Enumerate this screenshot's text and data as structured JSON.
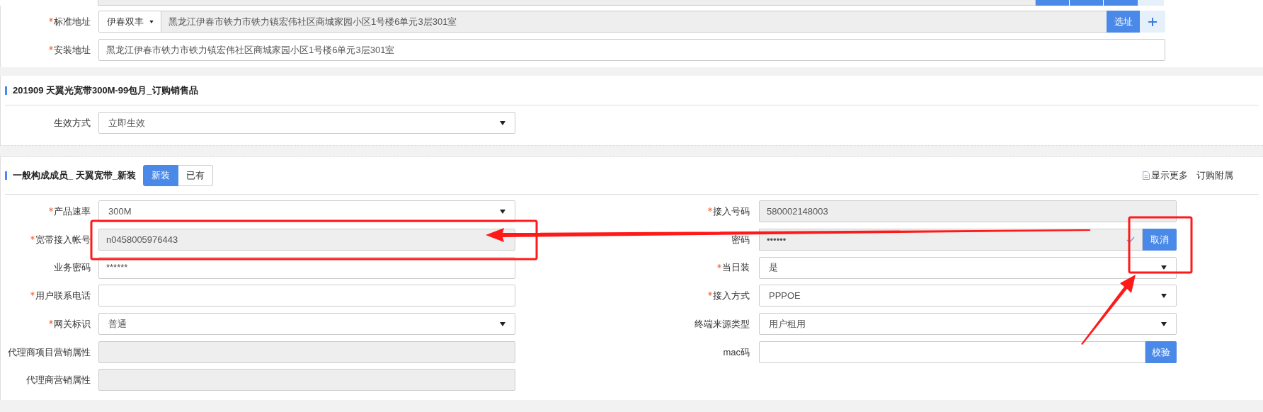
{
  "address_rows": [
    {
      "label": "标准地址",
      "required": true,
      "kind": "address_select",
      "city": "伊春双丰",
      "value": "黑龙江伊春市铁力市铁力镇宏伟社区商城家园小区1号楼6单元3层301室",
      "button": "选址"
    },
    {
      "label": "安装地址",
      "required": true,
      "kind": "text",
      "value": "黑龙江伊春市铁力市铁力镇宏伟社区商城家园小区1号楼6单元3层301室"
    }
  ],
  "offer_section": {
    "title": "201909 天翼光宽带300M-99包月_订购销售品",
    "fields": [
      {
        "label": "生效方式",
        "required": false,
        "kind": "select",
        "value": "立即生效"
      }
    ]
  },
  "member_section": {
    "title": "一般构成成员_ 天翼宽带_新装",
    "toggle": [
      {
        "label": "新装",
        "selected": true
      },
      {
        "label": "已有",
        "selected": false
      }
    ],
    "links": [
      {
        "label": "显示更多",
        "kind": "doc"
      },
      {
        "label": "订购附属",
        "kind": "plain"
      }
    ],
    "left_fields": [
      {
        "label": "产品速率",
        "required": true,
        "kind": "select",
        "value": "300M"
      },
      {
        "label": "宽带接入帐号",
        "required": true,
        "kind": "readonly",
        "value": "n0458005976443"
      },
      {
        "label": "业务密码",
        "required": false,
        "kind": "text",
        "value": "******"
      },
      {
        "label": "用户联系电话",
        "required": true,
        "kind": "text"
      },
      {
        "label": "网关标识",
        "required": true,
        "kind": "select",
        "value": "普通"
      },
      {
        "label": "代理商项目营销属性",
        "required": false,
        "kind": "readonly"
      },
      {
        "label": "代理商营销属性",
        "required": false,
        "kind": "readonly"
      }
    ],
    "right_fields": [
      {
        "label": "接入号码",
        "required": true,
        "kind": "readonly",
        "value": "580002148003"
      },
      {
        "label": "密码",
        "required": false,
        "kind": "confirm",
        "value": "••••••",
        "button": "取消"
      },
      {
        "label": "当日装",
        "required": true,
        "kind": "select",
        "value": "是"
      },
      {
        "label": "接入方式",
        "required": true,
        "kind": "select",
        "value": "PPPOE"
      },
      {
        "label": "终端来源类型",
        "required": false,
        "kind": "select",
        "value": "用户租用"
      },
      {
        "label": "mac码",
        "required": false,
        "kind": "button",
        "button": "校验"
      }
    ]
  }
}
